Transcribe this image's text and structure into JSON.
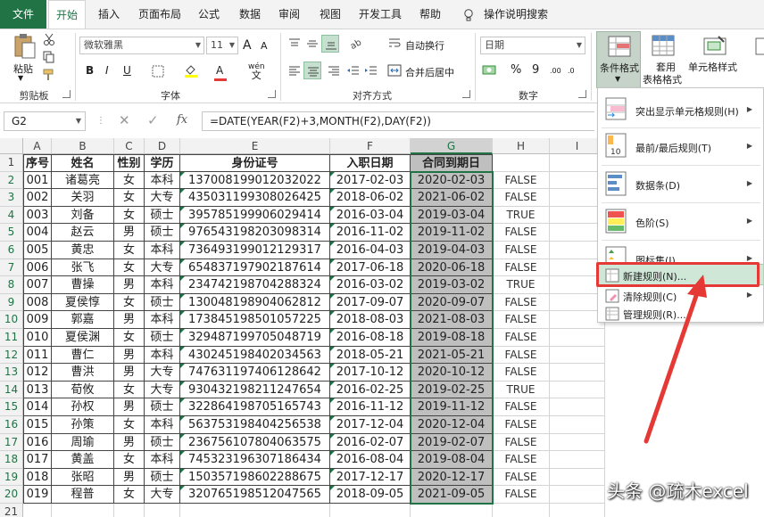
{
  "tabs": [
    "文件",
    "开始",
    "插入",
    "页面布局",
    "公式",
    "数据",
    "审阅",
    "视图",
    "开发工具",
    "帮助",
    "操作说明搜索"
  ],
  "ribbon": {
    "paste_label": "粘贴",
    "clipboard_label": "剪贴板",
    "font_name": "微软雅黑",
    "font_size": "11",
    "font_label": "字体",
    "wrap_label": "自动换行",
    "merge_label": "合并后居中",
    "align_label": "对齐方式",
    "number_format": "日期",
    "number_label": "数字",
    "percent": "%",
    "comma": "9",
    "cond_format_label": "条件格式",
    "table_format_label": [
      "套用",
      "表格格式"
    ],
    "cell_style_label": "单元格样式",
    "bold": "B",
    "italic": "I",
    "underline": "U",
    "font_color_letter": "A",
    "wen": "wén",
    "wen_char": "文",
    "grow": "A",
    "shrink": "A",
    "dec_inc": ".00",
    "dec_dec": ".0"
  },
  "formula_bar": {
    "name_box": "G2",
    "formula": "=DATE(YEAR(F2)+3,MONTH(F2),DAY(F2))"
  },
  "columns": [
    "A",
    "B",
    "C",
    "D",
    "E",
    "F",
    "G",
    "H",
    "I"
  ],
  "headers": [
    "序号",
    "姓名",
    "性别",
    "学历",
    "身份证号",
    "入职日期",
    "合同到期日"
  ],
  "rows": [
    [
      "001",
      "诸葛亮",
      "女",
      "本科",
      "137008199012032022",
      "2017-02-03",
      "2020-02-03",
      "FALSE"
    ],
    [
      "002",
      "关羽",
      "女",
      "大专",
      "435031199308026425",
      "2018-06-02",
      "2021-06-02",
      "FALSE"
    ],
    [
      "003",
      "刘备",
      "女",
      "硕士",
      "395785199906029414",
      "2016-03-04",
      "2019-03-04",
      "TRUE"
    ],
    [
      "004",
      "赵云",
      "男",
      "硕士",
      "976543198203098314",
      "2016-11-02",
      "2019-11-02",
      "FALSE"
    ],
    [
      "005",
      "黄忠",
      "女",
      "本科",
      "736493199012129317",
      "2016-04-03",
      "2019-04-03",
      "FALSE"
    ],
    [
      "006",
      "张飞",
      "女",
      "大专",
      "654837197902187614",
      "2017-06-18",
      "2020-06-18",
      "FALSE"
    ],
    [
      "007",
      "曹操",
      "男",
      "本科",
      "234742198704288324",
      "2016-03-02",
      "2019-03-02",
      "TRUE"
    ],
    [
      "008",
      "夏侯惇",
      "女",
      "硕士",
      "130048198904062812",
      "2017-09-07",
      "2020-09-07",
      "FALSE"
    ],
    [
      "009",
      "郭嘉",
      "男",
      "本科",
      "173845198501057225",
      "2018-08-03",
      "2021-08-03",
      "FALSE"
    ],
    [
      "010",
      "夏侯渊",
      "女",
      "硕士",
      "329487199705048719",
      "2016-08-18",
      "2019-08-18",
      "FALSE"
    ],
    [
      "011",
      "曹仁",
      "男",
      "本科",
      "430245198402034563",
      "2018-05-21",
      "2021-05-21",
      "FALSE"
    ],
    [
      "012",
      "曹洪",
      "男",
      "大专",
      "747631197406128642",
      "2017-10-12",
      "2020-10-12",
      "FALSE"
    ],
    [
      "013",
      "荀攸",
      "女",
      "大专",
      "930432198211247654",
      "2016-02-25",
      "2019-02-25",
      "TRUE"
    ],
    [
      "014",
      "孙权",
      "男",
      "硕士",
      "322864198705165743",
      "2016-11-12",
      "2019-11-12",
      "FALSE"
    ],
    [
      "015",
      "孙策",
      "女",
      "本科",
      "563753198404256538",
      "2017-12-04",
      "2020-12-04",
      "FALSE"
    ],
    [
      "016",
      "周瑜",
      "男",
      "硕士",
      "236756107804063575",
      "2016-02-07",
      "2019-02-07",
      "FALSE"
    ],
    [
      "017",
      "黄盖",
      "女",
      "本科",
      "745323196307186434",
      "2016-08-04",
      "2019-08-04",
      "FALSE"
    ],
    [
      "018",
      "张昭",
      "男",
      "硕士",
      "150357198602288675",
      "2017-12-17",
      "2020-12-17",
      "FALSE"
    ],
    [
      "019",
      "程普",
      "女",
      "大专",
      "320765198512047565",
      "2018-09-05",
      "2021-09-05",
      "FALSE"
    ]
  ],
  "row_numbers": [
    "1",
    "2",
    "3",
    "4",
    "5",
    "6",
    "7",
    "8",
    "9",
    "10",
    "11",
    "12",
    "13",
    "14",
    "15",
    "16",
    "17",
    "18",
    "19",
    "20",
    "21"
  ],
  "menu": [
    {
      "label": "突出显示单元格规则(H)",
      "icon": "highlight-rules-icon",
      "arrow": "▶"
    },
    {
      "label": "最前/最后规则(T)",
      "icon": "top-bottom-rules-icon",
      "arrow": "▶"
    },
    {
      "label": "数据条(D)",
      "icon": "data-bars-icon",
      "arrow": "▶"
    },
    {
      "label": "色阶(S)",
      "icon": "color-scales-icon",
      "arrow": "▶"
    },
    {
      "label": "图标集(I)",
      "icon": "icon-sets-icon",
      "arrow": "▶"
    },
    {
      "label": "新建规则(N)...",
      "icon": "new-rule-icon"
    },
    {
      "label": "清除规则(C)",
      "icon": "clear-rules-icon",
      "arrow": "▶"
    },
    {
      "label": "管理规则(R)...",
      "icon": "manage-rules-icon"
    }
  ],
  "menu_icon_text": "10",
  "watermark": "头条 @疏木excel",
  "colors": {
    "excel_green": "#217346",
    "highlight_red": "#e53935",
    "selected_fill": "#bfbfbf"
  }
}
